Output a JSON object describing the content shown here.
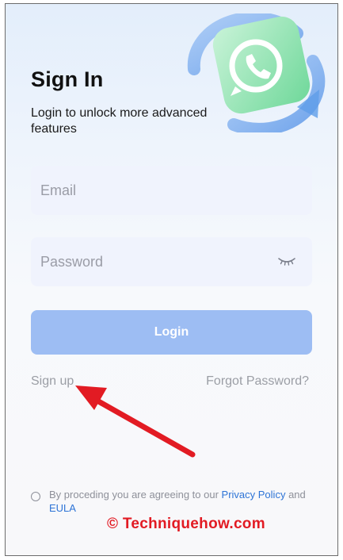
{
  "signin": {
    "title": "Sign In",
    "subtitle": "Login to unlock more advanced features",
    "email_placeholder": "Email",
    "password_placeholder": "Password",
    "login_label": "Login",
    "signup_label": "Sign up",
    "forgot_label": "Forgot Password?"
  },
  "terms": {
    "prefix": "By proceding you are agreeing to our ",
    "privacy_link": "Privacy Policy",
    "and": " and ",
    "eula_link": "EULA"
  },
  "watermark": "© Techniquehow.com",
  "icons": {
    "hero": "whatsapp-logo-icon",
    "password_toggle": "eye-closed-icon",
    "annotation": "red-arrow-icon"
  },
  "colors": {
    "login_button": "#9dbdf3",
    "field_bg": "#f0f3fd",
    "link_blue": "#2e74d6",
    "watermark_red": "#e21b23",
    "arrow_red": "#e21b23"
  }
}
